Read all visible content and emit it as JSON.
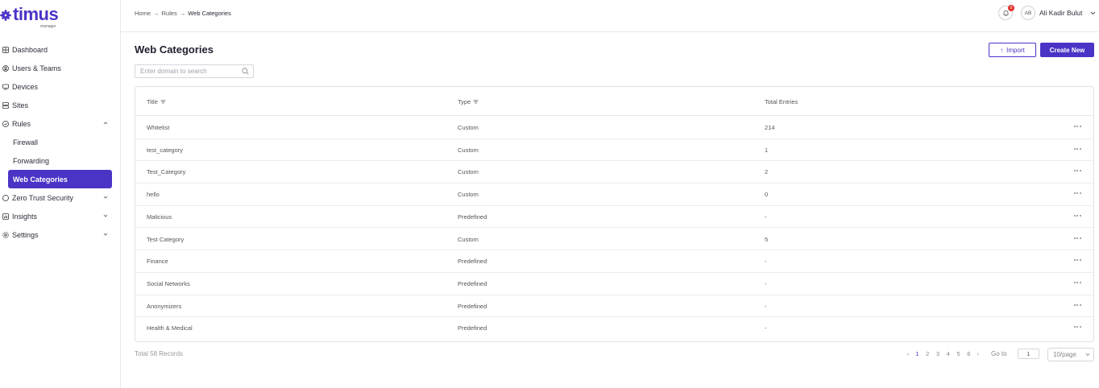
{
  "brand": {
    "name": "timus",
    "sub": "manager",
    "color": "#4a34c6"
  },
  "sidebar": {
    "items": [
      {
        "label": "Dashboard",
        "icon": "dashboard-icon"
      },
      {
        "label": "Users & Teams",
        "icon": "users-icon"
      },
      {
        "label": "Devices",
        "icon": "devices-icon"
      },
      {
        "label": "Sites",
        "icon": "sites-icon"
      },
      {
        "label": "Rules",
        "icon": "rules-icon",
        "expanded": true
      },
      {
        "label": "Zero Trust Security",
        "icon": "shield-icon"
      },
      {
        "label": "Insights",
        "icon": "insights-icon"
      },
      {
        "label": "Settings",
        "icon": "settings-icon"
      }
    ],
    "rules_children": [
      {
        "label": "Firewall"
      },
      {
        "label": "Forwarding"
      },
      {
        "label": "Web Categories",
        "active": true
      }
    ]
  },
  "header": {
    "breadcrumb": [
      "Home",
      "Rules",
      "Web Categories"
    ],
    "notifications": "0",
    "avatar_initials": "AB",
    "user_name": "Ali Kadir Bulut"
  },
  "main": {
    "title": "Web Categories",
    "import_label": "Import",
    "create_label": "Create New",
    "search_placeholder": "Enter domain to search"
  },
  "table": {
    "columns": [
      "Title",
      "Type",
      "Total Entries"
    ],
    "rows": [
      {
        "title": "Whitelist",
        "type": "Custom",
        "entries": "214"
      },
      {
        "title": "test_category",
        "type": "Custom",
        "entries": "1"
      },
      {
        "title": "Test_Category",
        "type": "Custom",
        "entries": "2"
      },
      {
        "title": "hello",
        "type": "Custom",
        "entries": "0"
      },
      {
        "title": "Malicious",
        "type": "Predefined",
        "entries": "-"
      },
      {
        "title": "Test Category",
        "type": "Custom",
        "entries": "5"
      },
      {
        "title": "Finance",
        "type": "Predefined",
        "entries": "-"
      },
      {
        "title": "Social Networks",
        "type": "Predefined",
        "entries": "-"
      },
      {
        "title": "Anonymizers",
        "type": "Predefined",
        "entries": "-"
      },
      {
        "title": "Health & Medical",
        "type": "Predefined",
        "entries": "-"
      }
    ]
  },
  "footer": {
    "total": "Total 58  Records",
    "pages": [
      "1",
      "2",
      "3",
      "4",
      "5",
      "6"
    ],
    "current_page": "1",
    "goto_label": "Go to",
    "goto_value": "1",
    "per_page": "10/page"
  }
}
